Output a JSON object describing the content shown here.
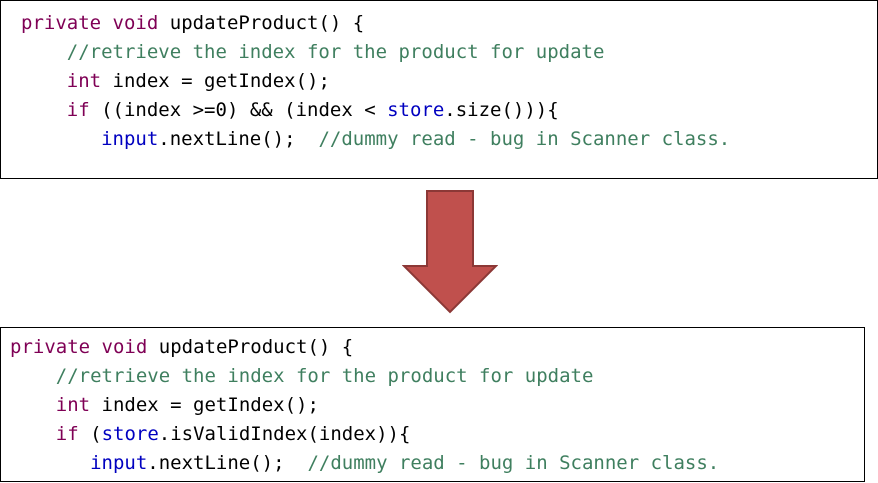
{
  "colors": {
    "keyword": "#7f0055",
    "comment": "#3f7f5f",
    "field": "#0000c0",
    "plain": "#000000",
    "arrow_fill": "#c0504d",
    "arrow_stroke": "#8c3836"
  },
  "icons": {
    "arrow": "arrow-down-icon"
  },
  "before": {
    "line1": {
      "kw1": "private",
      "kw2": "void",
      "rest": "updateProduct() {"
    },
    "line2": {
      "comment": "//retrieve the index for the product for update"
    },
    "line3": {
      "kw": "int",
      "rest": "index = getIndex();"
    },
    "line4": {
      "kw": "if",
      "before": "((index >=0) && (index < ",
      "field": "store",
      "after": ".size())){"
    },
    "line5": {
      "field": "input",
      "rest": ".nextLine();  ",
      "comment": "//dummy read - bug in Scanner class."
    }
  },
  "after": {
    "line1": {
      "kw1": "private",
      "kw2": "void",
      "rest": "updateProduct() {"
    },
    "line2": {
      "comment": "//retrieve the index for the product for update"
    },
    "line3": {
      "kw": "int",
      "rest": "index = getIndex();"
    },
    "line4": {
      "kw": "if",
      "before": "(",
      "field": "store",
      "after": ".isValidIndex(index)){"
    },
    "line5": {
      "field": "input",
      "rest": ".nextLine();  ",
      "comment": "//dummy read - bug in Scanner class."
    }
  }
}
